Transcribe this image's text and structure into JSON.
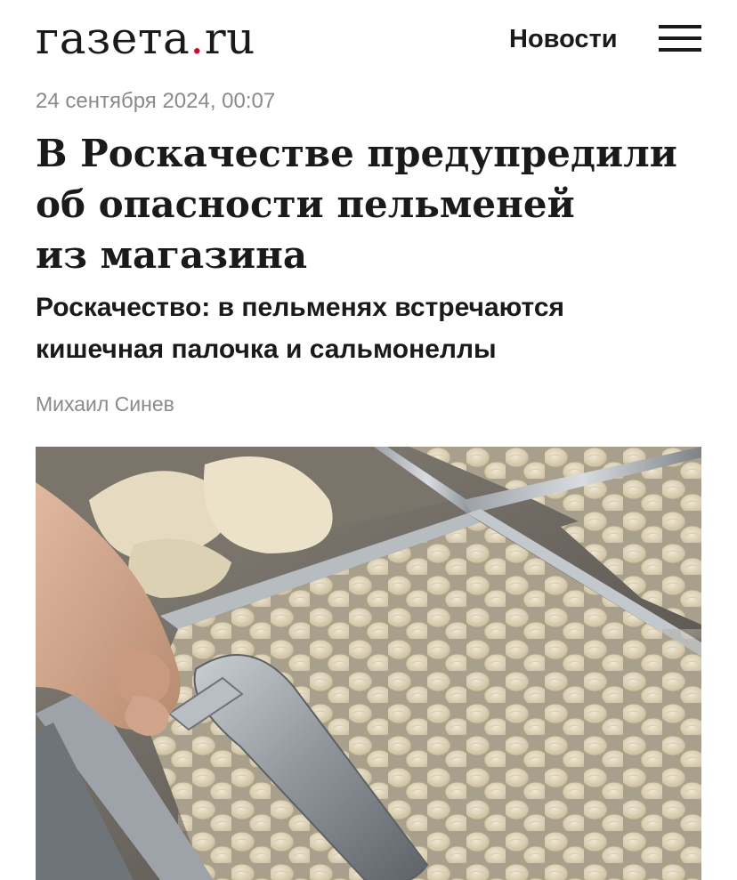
{
  "header": {
    "logo_text": "газета",
    "logo_dot": ".",
    "logo_tld": "ru",
    "nav_label": "Новости",
    "menu_icon": "hamburger-menu-icon"
  },
  "article": {
    "date": "24 сентября 2024, 00:07",
    "headline_lines": [
      "В Роскачестве предупредили",
      "об опасности пельменей",
      "из магазина"
    ],
    "subheadline_lines": [
      "Роскачество: в пельменях встречаются",
      "кишечная палочка и сальмонеллы"
    ],
    "author": "Михаил Синев"
  },
  "colors": {
    "text": "#1a1a1a",
    "meta_text": "#8a8a8a",
    "logo_dot": "#c8102e",
    "background": "#ffffff"
  }
}
